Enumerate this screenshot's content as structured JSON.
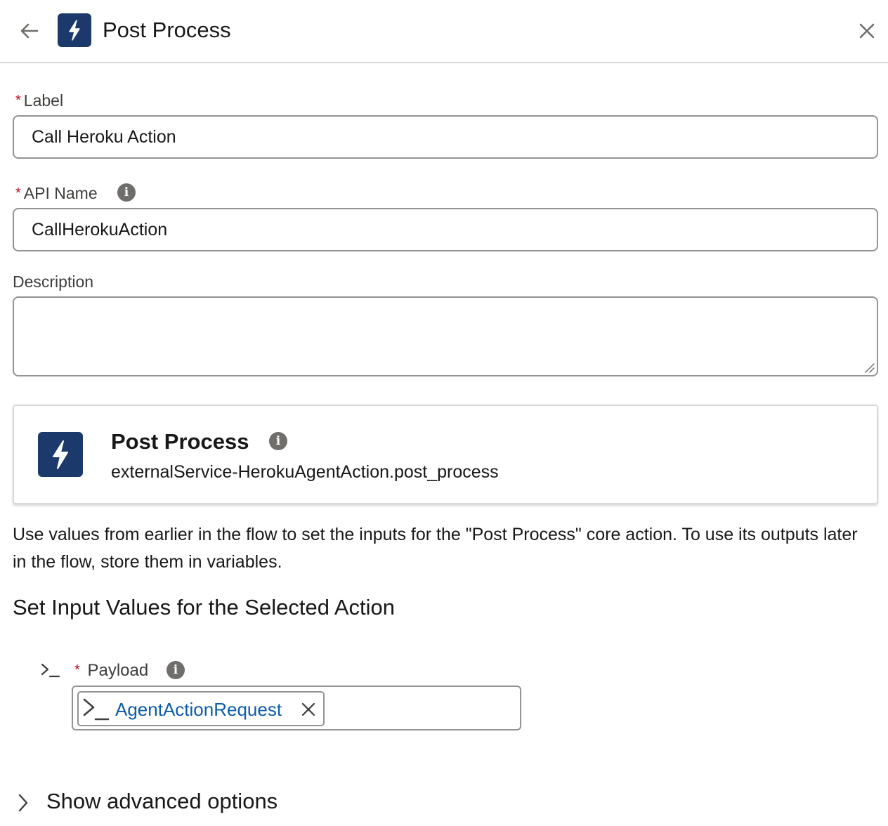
{
  "header": {
    "title": "Post Process",
    "icon": "lightning-icon",
    "back_icon": "arrow-left-icon",
    "close_icon": "close-icon"
  },
  "form": {
    "required_marker": "*",
    "label_field": {
      "label": "Label",
      "value": "Call Heroku Action"
    },
    "api_name_field": {
      "label": "API Name",
      "value": "CallHerokuAction"
    },
    "description_field": {
      "label": "Description",
      "value": ""
    }
  },
  "action_card": {
    "title": "Post Process",
    "subtitle": "externalService-HerokuAgentAction.post_process",
    "icon": "lightning-icon",
    "brand_color": "#1b3a6b"
  },
  "help_text": "Use values from earlier in the flow to set the inputs for the \"Post Process\" core action. To use its outputs later in the flow, store them in variables.",
  "inputs_section": {
    "heading": "Set Input Values for the Selected Action",
    "payload": {
      "label": "Payload",
      "selected_pill": "AgentActionRequest",
      "pill_color": "#0b5cab"
    }
  },
  "advanced": {
    "label": "Show advanced options"
  },
  "colors": {
    "required": "#ba0517",
    "border": "#939393",
    "link": "#0b5cab"
  }
}
